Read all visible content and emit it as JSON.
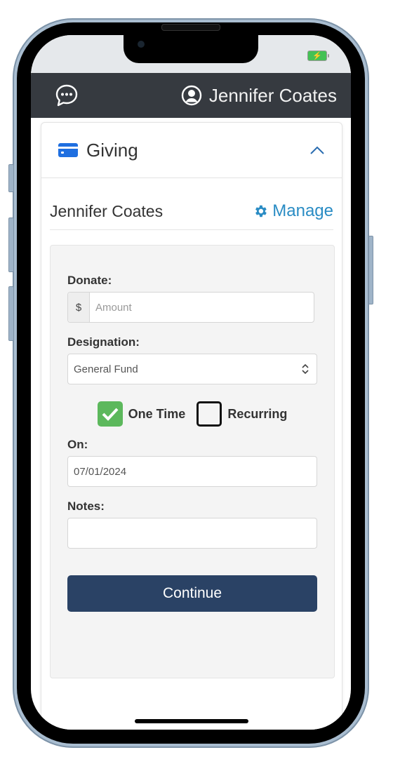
{
  "status_bar": {
    "battery_icon": "battery-charging-icon",
    "battery_glyph": "⚡"
  },
  "app_bar": {
    "chat_icon": "chat-bubble-icon",
    "user_icon": "user-circle-icon",
    "user_name": "Jennifer Coates"
  },
  "giving_card": {
    "title": "Giving",
    "title_icon": "credit-card-icon",
    "collapse_icon": "chevron-up-icon",
    "account_name": "Jennifer Coates",
    "manage_label": "Manage",
    "manage_icon": "gear-icon"
  },
  "form": {
    "donate_label": "Donate:",
    "currency_symbol": "$",
    "amount_placeholder": "Amount",
    "amount_value": "",
    "designation_label": "Designation:",
    "designation_value": "General Fund",
    "frequency": {
      "one_time_label": "One Time",
      "one_time_checked": true,
      "recurring_label": "Recurring",
      "recurring_checked": false
    },
    "on_label": "On:",
    "date_value": "07/01/2024",
    "notes_label": "Notes:",
    "notes_value": "",
    "continue_label": "Continue"
  },
  "colors": {
    "app_bar": "#363a40",
    "accent": "#2a8cc4",
    "card_icon": "#1f6fe0",
    "check_on": "#5cb85c",
    "continue_button": "#2a4265"
  }
}
